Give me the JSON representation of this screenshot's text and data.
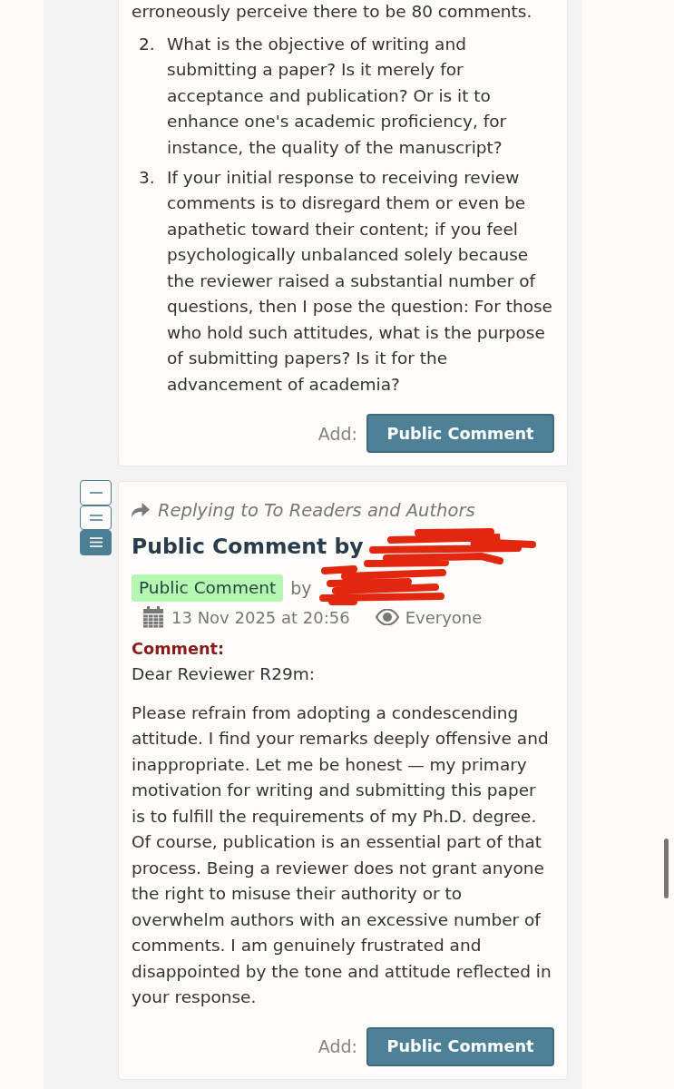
{
  "previous_comment": {
    "text_tail": "erroneously perceive there to be 80 comments.",
    "list": [
      {
        "number": "2.",
        "text": "What is the objective of writing and submitting a paper? Is it merely for acceptance and publication? Or is it to enhance one's academic proficiency, for instance, the quality of the manuscript?"
      },
      {
        "number": "3.",
        "text": "If your initial response to receiving review comments is to disregard them or even be apathetic toward their content; if you feel psychologically unbalanced solely because the reviewer raised a substantial number of questions, then I pose the question: For those who hold such attitudes, what is the purpose of submitting papers? Is it for the advancement of academia?"
      }
    ],
    "add_label": "Add:",
    "add_button": "Public Comment"
  },
  "view_toggles": [
    {
      "kind": "single",
      "selected": false
    },
    {
      "kind": "double",
      "selected": false
    },
    {
      "kind": "triple",
      "selected": true
    }
  ],
  "reply": {
    "replying_to": "Replying to To Readers and Authors",
    "title": "Public Comment by",
    "redacted": true,
    "badge": "Public Comment",
    "by": "by",
    "date": "13 Nov 2025 at 20:56",
    "visibility": "Everyone",
    "field_label": "Comment:",
    "paragraphs": [
      "Dear Reviewer R29m:",
      "Please refrain from adopting a condescending attitude. I find your remarks deeply offensive and inappropriate. Let me be honest — my primary motivation for writing and submitting this paper is to fulfill the requirements of my Ph.D. degree. Of course, publication is an essential part of that process. Being a reviewer does not grant anyone the right to misuse their authority or to overwhelm authors with an excessive number of comments. I am genuinely frustrated and disappointed by the tone and attitude reflected in your response."
    ],
    "add_label": "Add:",
    "add_button": "Public Comment"
  }
}
